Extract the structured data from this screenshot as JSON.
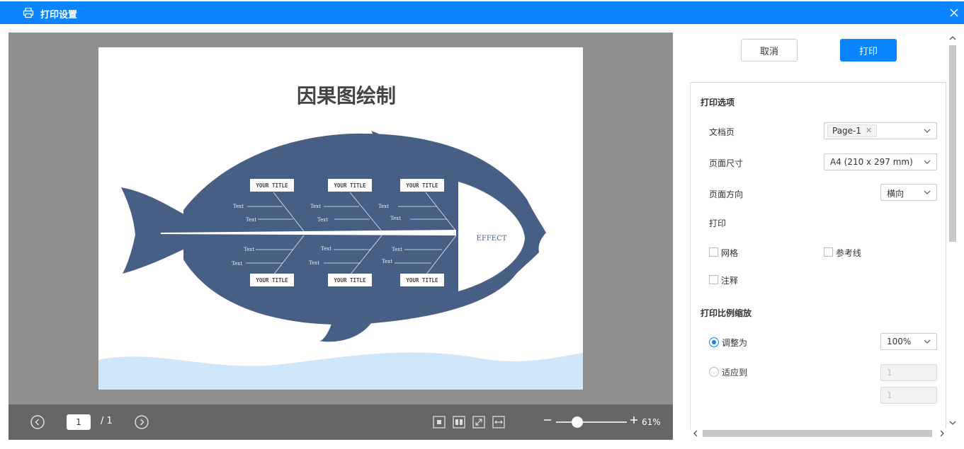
{
  "dialog": {
    "title": "打印设置"
  },
  "preview": {
    "document": {
      "title": "因果图绘制",
      "effect": "EFFECT",
      "top_titles": [
        "YOUR TITLE",
        "YOUR TITLE",
        "YOUR TITLE"
      ],
      "bottom_titles": [
        "YOUR TITLE",
        "YOUR TITLE",
        "YOUR TITLE"
      ],
      "text_label": "Text",
      "colors": {
        "fish": "#485f85",
        "water": "#cfe7f8"
      }
    },
    "nav": {
      "current_page": "1",
      "total_pages": "/ 1",
      "zoom": "61%",
      "zoom_level": 0.3
    }
  },
  "actions": {
    "cancel": "取消",
    "print": "打印"
  },
  "options": {
    "section_title": "打印选项",
    "doc_pages_label": "文档页",
    "doc_page_tag": "Page-1",
    "page_size_label": "页面尺寸",
    "page_size_value": "A4 (210 x 297 mm)",
    "orientation_label": "页面方向",
    "orientation_value": "横向",
    "print_label": "打印",
    "grid_label": "网格",
    "guides_label": "参考线",
    "notes_label": "注释"
  },
  "scale": {
    "section_title": "打印比例缩放",
    "adjust_label": "调整为",
    "adjust_value": "100%",
    "fit_label": "适应到",
    "fit_width": "1",
    "fit_height": "1"
  },
  "theme": {
    "accent": "#0a84ff",
    "preview_bg": "#8f8f8f",
    "toolbar_bg": "#666666"
  }
}
